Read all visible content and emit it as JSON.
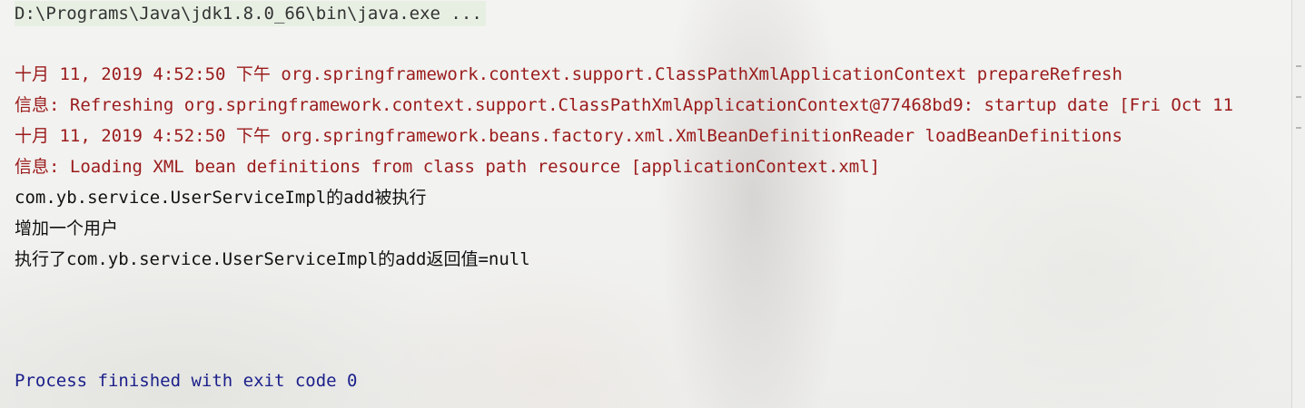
{
  "console": {
    "command": "D:\\Programs\\Java\\jdk1.8.0_66\\bin\\java.exe ...",
    "lines": [
      "十月 11, 2019 4:52:50 下午 org.springframework.context.support.ClassPathXmlApplicationContext prepareRefresh",
      "信息: Refreshing org.springframework.context.support.ClassPathXmlApplicationContext@77468bd9: startup date [Fri Oct 11",
      "十月 11, 2019 4:52:50 下午 org.springframework.beans.factory.xml.XmlBeanDefinitionReader loadBeanDefinitions",
      "信息: Loading XML bean definitions from class path resource [applicationContext.xml]",
      "com.yb.service.UserServiceImpl的add被执行",
      "增加一个用户",
      "执行了com.yb.service.UserServiceImpl的add返回值=null"
    ],
    "exit_message": "Process finished with exit code 0"
  },
  "colors": {
    "stderr": "#9a1b1b",
    "stdout": "#111111",
    "process_finished": "#1a1f8a"
  }
}
